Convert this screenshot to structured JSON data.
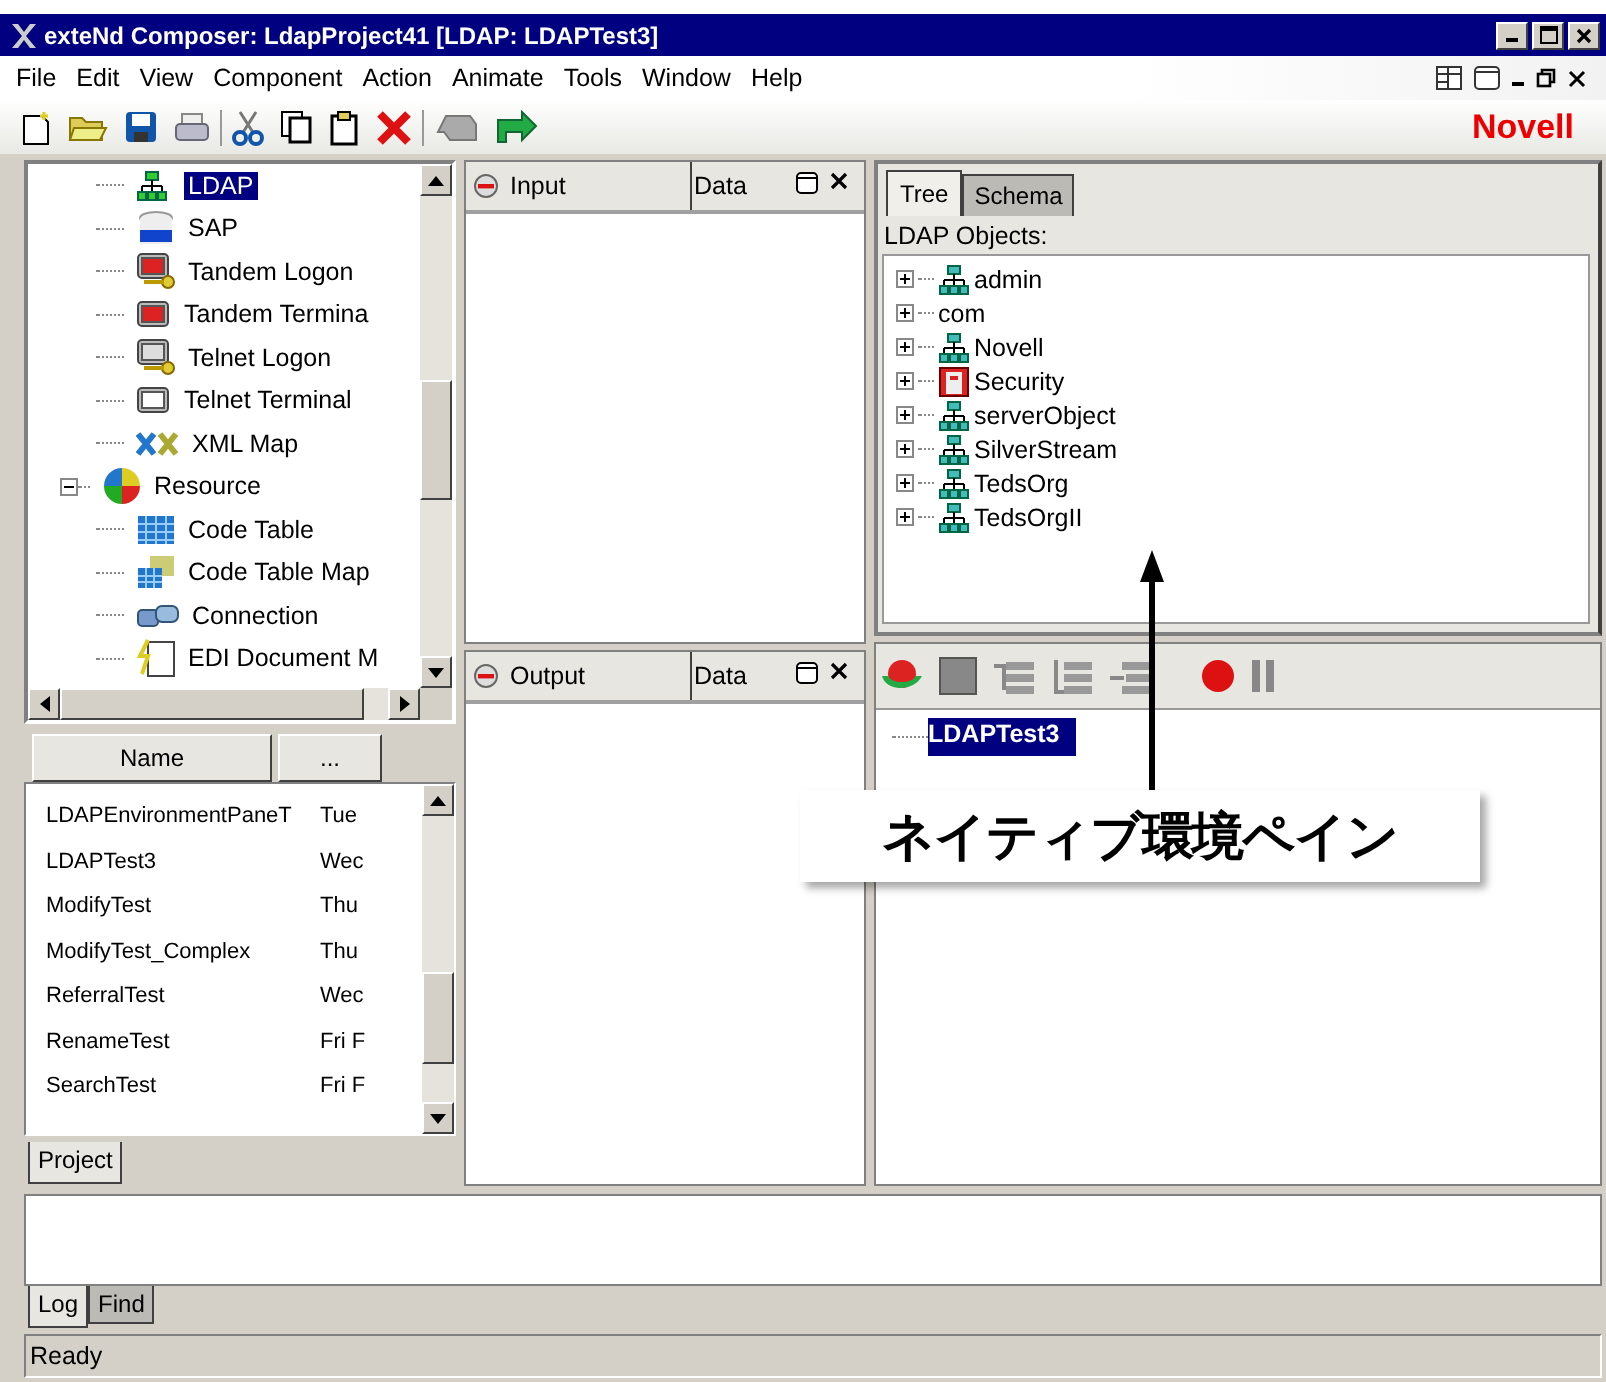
{
  "window": {
    "title": "exteNd Composer: LdapProject41 [LDAP: LDAPTest3]"
  },
  "menu": [
    "File",
    "Edit",
    "View",
    "Component",
    "Action",
    "Animate",
    "Tools",
    "Window",
    "Help"
  ],
  "brand": "Novell",
  "component_tree": {
    "items": [
      {
        "children": [
          {
            "label": "LDAP",
            "kind": "ldap",
            "selected": true
          },
          {
            "label": "SAP",
            "kind": "sap",
            "selected": false
          },
          {
            "label": "Tandem Logon",
            "kind": "tandem-logon",
            "selected": false
          },
          {
            "label": "Tandem Termina",
            "kind": "tandem-terminal",
            "selected": false
          },
          {
            "label": "Telnet Logon",
            "kind": "telnet-logon",
            "selected": false
          },
          {
            "label": "Telnet Terminal",
            "kind": "telnet-terminal",
            "selected": false
          },
          {
            "label": "XML Map",
            "kind": "xml-map",
            "selected": false
          }
        ]
      },
      {
        "label": "Resource",
        "kind": "resource",
        "selected": false,
        "expanded": true,
        "children": [
          {
            "label": "Code Table",
            "kind": "code-table",
            "selected": false
          },
          {
            "label": "Code Table Map",
            "kind": "code-table-map",
            "selected": false
          },
          {
            "label": "Connection",
            "kind": "connection",
            "selected": false
          },
          {
            "label": "EDI Document M",
            "kind": "edi",
            "selected": false
          }
        ]
      }
    ]
  },
  "project_table": {
    "columns": [
      "Name",
      "..."
    ],
    "rows": [
      {
        "name": "LDAPEnvironmentPaneT",
        "column_2": "Tue"
      },
      {
        "name": "LDAPTest3",
        "column_2": "Wec"
      },
      {
        "name": "ModifyTest",
        "column_2": "Thu"
      },
      {
        "name": "ModifyTest_Complex",
        "column_2": "Thu"
      },
      {
        "name": "ReferralTest",
        "column_2": "Wec"
      },
      {
        "name": "RenameTest",
        "column_2": "Fri F"
      },
      {
        "name": "SearchTest",
        "column_2": "Fri F"
      }
    ]
  },
  "left_tabs": [
    {
      "label": "Project",
      "selected": true
    }
  ],
  "input_pane": {
    "title": "Input",
    "column": "Data"
  },
  "output_pane": {
    "title": "Output",
    "column": "Data"
  },
  "ldap_panel": {
    "tabs": [
      {
        "label": "Tree",
        "selected": true
      },
      {
        "label": "Schema",
        "selected": false
      }
    ],
    "heading": "LDAP Objects:",
    "items": [
      {
        "label": "admin",
        "kind": "container",
        "expanded": false
      },
      {
        "label": "com",
        "kind": "plain",
        "expanded": false
      },
      {
        "label": "Novell",
        "kind": "container",
        "expanded": false
      },
      {
        "label": "Security",
        "kind": "security",
        "expanded": false
      },
      {
        "label": "serverObject",
        "kind": "container",
        "expanded": false
      },
      {
        "label": "SilverStream",
        "kind": "container",
        "expanded": false
      },
      {
        "label": "TedsOrg",
        "kind": "container",
        "expanded": false
      },
      {
        "label": "TedsOrgII",
        "kind": "container",
        "expanded": false
      }
    ]
  },
  "test_tree": {
    "items": [
      {
        "label": "LDAPTest3",
        "selected": true
      }
    ]
  },
  "callout": {
    "text": "ネイティブ環境ペイン"
  },
  "log_tabs": [
    {
      "label": "Log",
      "selected": true
    },
    {
      "label": "Find",
      "selected": false
    }
  ],
  "status_bar": "Ready"
}
